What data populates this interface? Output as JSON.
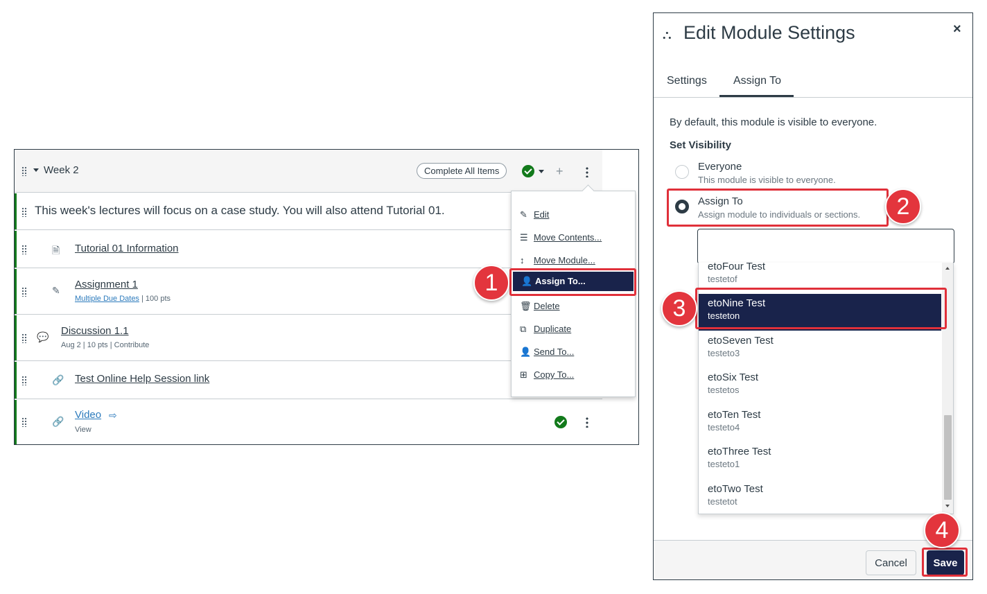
{
  "module": {
    "title": "Week 2",
    "complete_all_label": "Complete All Items",
    "subheader": "This week's lectures will focus on a case study. You will also attend Tutorial 01.",
    "items": [
      {
        "title": "Tutorial 01 Information",
        "icon": "page-icon"
      },
      {
        "title": "Assignment 1",
        "icon": "assignment-icon",
        "due_link": "Multiple Due Dates",
        "meta": "|  100 pts"
      },
      {
        "title": "Discussion 1.1",
        "icon": "discussion-icon",
        "meta": "Aug 2  |  10 pts  |  Contribute"
      },
      {
        "title": "Test Online Help Session link",
        "icon": "link-icon"
      },
      {
        "title": "Video",
        "icon": "external-link-icon",
        "meta": "View"
      }
    ]
  },
  "menu": {
    "items": [
      {
        "label": "Edit",
        "icon": "pencil-icon"
      },
      {
        "label": "Move Contents...",
        "icon": "move-contents-icon"
      },
      {
        "label": "Move Module...",
        "icon": "move-vertical-icon"
      },
      {
        "label": "Assign To...",
        "icon": "assign-user-icon"
      },
      {
        "label": "Delete",
        "icon": "trash-icon"
      },
      {
        "label": "Duplicate",
        "icon": "duplicate-icon"
      },
      {
        "label": "Send To...",
        "icon": "send-user-icon"
      },
      {
        "label": "Copy To...",
        "icon": "copy-icon"
      }
    ]
  },
  "dialog": {
    "title": "Edit Module Settings",
    "close": "×",
    "tabs": [
      "Settings",
      "Assign To"
    ],
    "active_tab": "Assign To",
    "intro": "By default, this module is visible to everyone.",
    "set_visibility": "Set Visibility",
    "options": [
      {
        "label": "Everyone",
        "desc": "This module is visible to everyone.",
        "checked": false
      },
      {
        "label": "Assign To",
        "desc": "Assign module to individuals or sections.",
        "checked": true
      }
    ],
    "search_value": "",
    "list": [
      {
        "name": "etoFour Test",
        "sub": "testetof"
      },
      {
        "name": "etoNine Test",
        "sub": "testeton",
        "selected": true
      },
      {
        "name": "etoSeven Test",
        "sub": "testeto3"
      },
      {
        "name": "etoSix Test",
        "sub": "testetos"
      },
      {
        "name": "etoTen Test",
        "sub": "testeto4"
      },
      {
        "name": "etoThree Test",
        "sub": "testeto1"
      },
      {
        "name": "etoTwo Test",
        "sub": "testetot"
      }
    ],
    "cancel_label": "Cancel",
    "save_label": "Save"
  },
  "steps": [
    "1",
    "2",
    "3",
    "4"
  ],
  "colors": {
    "accent_navy": "#19234b",
    "callout_red": "#e3353d",
    "success_green": "#127a1b"
  }
}
